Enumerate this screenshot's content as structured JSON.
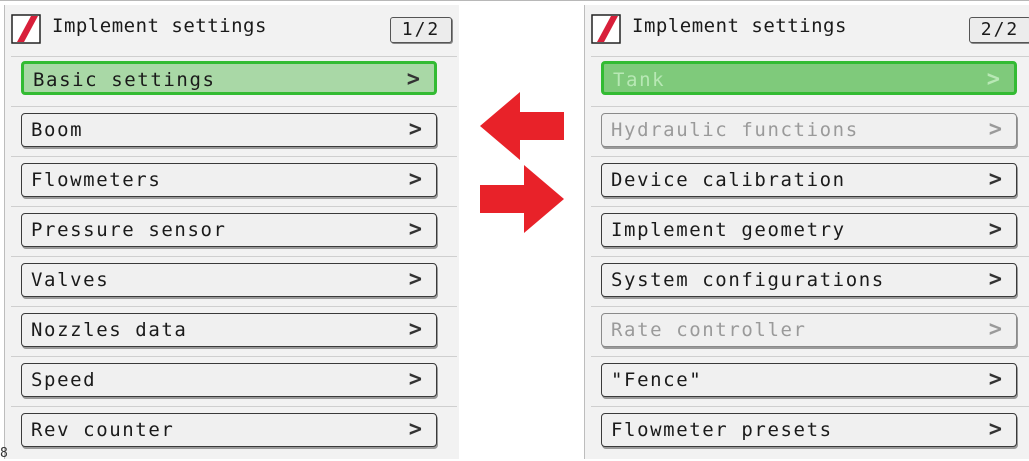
{
  "colors": {
    "arrow": "#e82229",
    "selected_fill": "#a9d8a6",
    "selected_border": "#33bb33",
    "tank_fill": "#7fca7b"
  },
  "corner_label": "8",
  "panel1": {
    "title": "Implement settings",
    "page": "1/2",
    "items": [
      {
        "label": "Basic settings",
        "chevron": ">"
      },
      {
        "label": "Boom",
        "chevron": ">"
      },
      {
        "label": "Flowmeters",
        "chevron": ">"
      },
      {
        "label": "Pressure sensor",
        "chevron": ">"
      },
      {
        "label": "Valves",
        "chevron": ">"
      },
      {
        "label": "Nozzles data",
        "chevron": ">"
      },
      {
        "label": "Speed",
        "chevron": ">"
      },
      {
        "label": "Rev counter",
        "chevron": ">"
      }
    ]
  },
  "panel2": {
    "title": "Implement settings",
    "page": "2/2",
    "items": [
      {
        "label": "Tank",
        "chevron": ">"
      },
      {
        "label": "Hydraulic functions",
        "chevron": ">"
      },
      {
        "label": "Device calibration",
        "chevron": ">"
      },
      {
        "label": "Implement geometry",
        "chevron": ">"
      },
      {
        "label": "System configurations",
        "chevron": ">"
      },
      {
        "label": "Rate controller",
        "chevron": ">"
      },
      {
        "label": "\"Fence\"",
        "chevron": ">"
      },
      {
        "label": "Flowmeter presets",
        "chevron": ">"
      }
    ]
  },
  "icons": {
    "logo": "implement-logo-icon",
    "prev": "arrow-left-icon",
    "next": "arrow-right-icon"
  }
}
